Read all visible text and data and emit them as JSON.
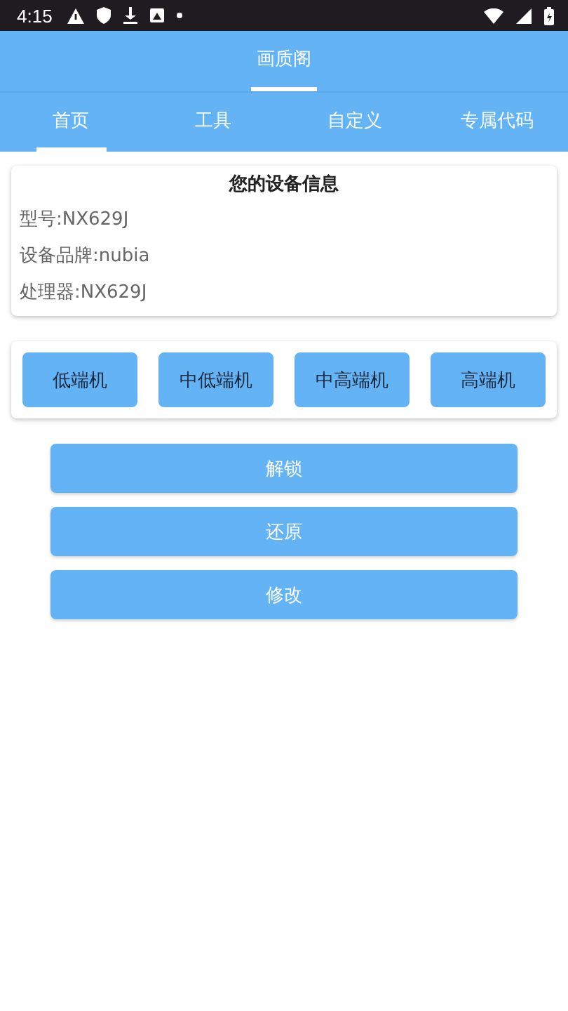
{
  "status_bar": {
    "time": "4:15"
  },
  "top_tabs": [
    {
      "label": "画质阁",
      "selected": true
    }
  ],
  "tabs": [
    {
      "label": "首页",
      "selected": true
    },
    {
      "label": "工具",
      "selected": false
    },
    {
      "label": "自定义",
      "selected": false
    },
    {
      "label": "专属代码",
      "selected": false
    }
  ],
  "device_info": {
    "title": "您的设备信息",
    "lines": [
      "型号:NX629J",
      "设备品牌:nubia",
      "处理器:NX629J"
    ]
  },
  "levels": [
    "低端机",
    "中低端机",
    "中高端机",
    "高端机"
  ],
  "actions": [
    "解锁",
    "还原",
    "修改"
  ]
}
